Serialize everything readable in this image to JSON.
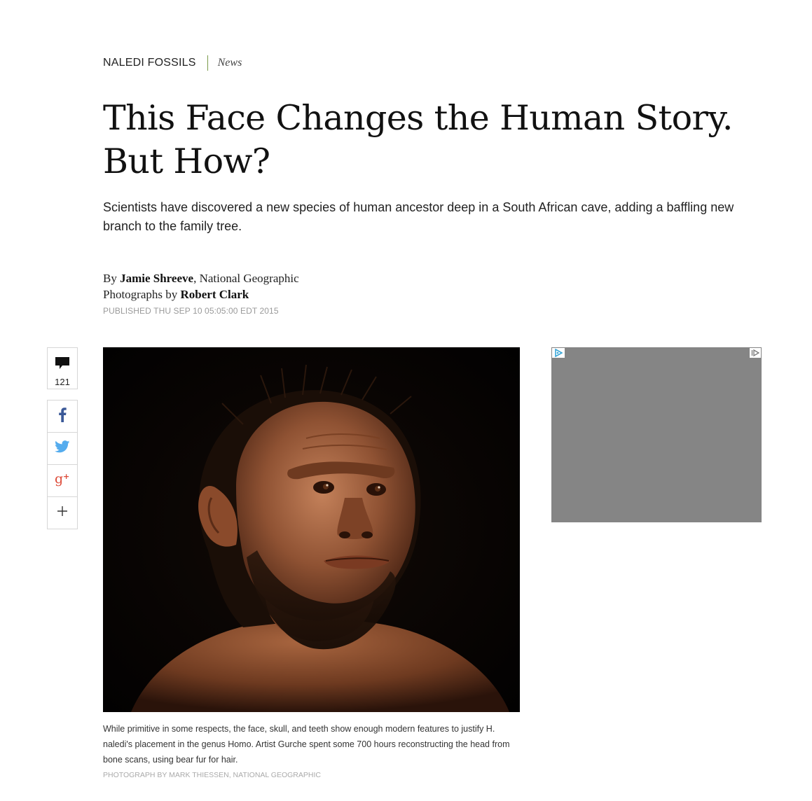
{
  "kicker": {
    "section": "NALEDI FOSSILS",
    "type": "News"
  },
  "headline": "This Face Changes the Human Story. But How?",
  "dek": "Scientists have discovered a new species of human ancestor deep in a South African cave, adding a baffling new branch to the family tree.",
  "byline": {
    "by_prefix": "By",
    "author": "Jamie Shreeve",
    "org_suffix": ", National Geographic",
    "photos_prefix": "Photographs by",
    "photographer": "Robert Clark"
  },
  "published": "PUBLISHED THU SEP 10 05:05:00 EDT 2015",
  "social": {
    "comment_count": "121",
    "icons": [
      "comment-icon",
      "facebook-icon",
      "twitter-icon",
      "google-plus-icon",
      "plus-icon"
    ]
  },
  "figure": {
    "caption": "While primitive in some respects, the face, skull, and teeth show enough modern features to justify H. naledi's placement in the genus Homo. Artist Gurche spent some 700 hours reconstructing the head from bone scans, using bear fur for hair.",
    "credit": "PHOTOGRAPH BY MARK THIESSEN, NATIONAL GEOGRAPHIC"
  },
  "ad": {
    "background": "#858585"
  },
  "colors": {
    "facebook": "#3b5998",
    "twitter": "#55acee",
    "google_plus": "#dd4b39",
    "kicker_divider": "#7a9a4a",
    "adchoices": "#3aa7d8"
  }
}
